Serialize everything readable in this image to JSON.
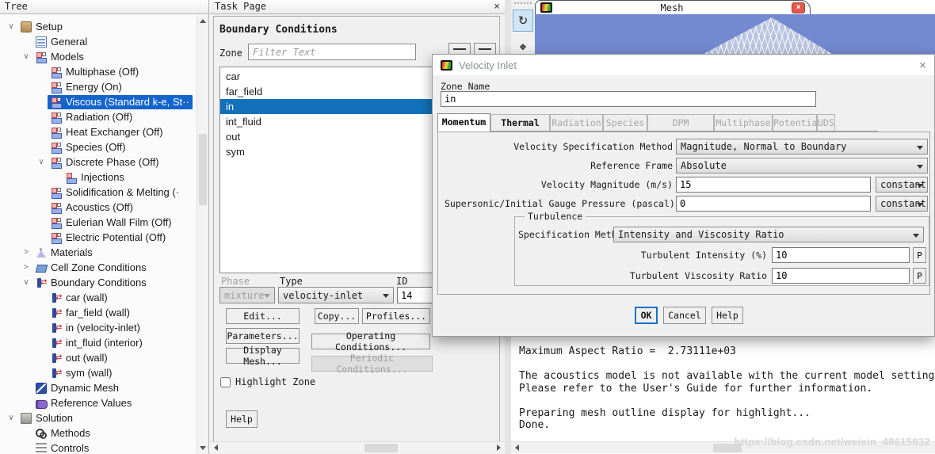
{
  "icons": {
    "close": "×",
    "expand_open": "∨",
    "expand_closed": ">"
  },
  "colors": {
    "selection_blue": "#1271b8",
    "tree_selection_blue": "#1464cc",
    "viewport_blue": "#7389cf",
    "tab_close_red": "#e2574c",
    "ok_border_blue": "#1373c6",
    "watermark_gray": "#d7d7d7"
  },
  "tree": {
    "header": "Tree",
    "items": [
      {
        "arrow": "v",
        "icon": "setup",
        "label": "Setup",
        "lvl": 0
      },
      {
        "icon": "general",
        "label": "General",
        "lvl": 1
      },
      {
        "arrow": "v",
        "icon": "model",
        "label": "Models",
        "lvl": 1
      },
      {
        "icon": "model",
        "label": "Multiphase (Off)",
        "lvl": 2
      },
      {
        "icon": "model",
        "label": "Energy (On)",
        "lvl": 2
      },
      {
        "icon": "model",
        "label": "Viscous (Standard k-e, St··",
        "lvl": 2,
        "selected": true
      },
      {
        "icon": "model",
        "label": "Radiation (Off)",
        "lvl": 2
      },
      {
        "icon": "model",
        "label": "Heat Exchanger (Off)",
        "lvl": 2
      },
      {
        "icon": "model",
        "label": "Species (Off)",
        "lvl": 2
      },
      {
        "arrow": "v",
        "icon": "model",
        "label": "Discrete Phase (Off)",
        "lvl": 2
      },
      {
        "icon": "injections",
        "label": "Injections",
        "lvl": 3
      },
      {
        "icon": "model",
        "label": "Solidification & Melting (·",
        "lvl": 2
      },
      {
        "icon": "model",
        "label": "Acoustics (Off)",
        "lvl": 2
      },
      {
        "icon": "model",
        "label": "Eulerian Wall Film (Off)",
        "lvl": 2
      },
      {
        "icon": "model",
        "label": "Electric Potential (Off)",
        "lvl": 2
      },
      {
        "arrow": ">",
        "icon": "materials",
        "label": "Materials",
        "lvl": 1
      },
      {
        "arrow": ">",
        "icon": "cellzone",
        "label": "Cell Zone Conditions",
        "lvl": 1
      },
      {
        "arrow": "v",
        "icon": "boundary",
        "label": "Boundary Conditions",
        "lvl": 1
      },
      {
        "icon": "boundary",
        "label": "car (wall)",
        "lvl": 2
      },
      {
        "icon": "boundary",
        "label": "far_field (wall)",
        "lvl": 2
      },
      {
        "icon": "boundary",
        "label": "in (velocity-inlet)",
        "lvl": 2
      },
      {
        "icon": "boundary",
        "label": "int_fluid (interior)",
        "lvl": 2
      },
      {
        "icon": "boundary",
        "label": "out (wall)",
        "lvl": 2
      },
      {
        "icon": "boundary",
        "label": "sym (wall)",
        "lvl": 2
      },
      {
        "icon": "dynmesh",
        "label": "Dynamic Mesh",
        "lvl": 1
      },
      {
        "icon": "refvals",
        "label": "Reference Values",
        "lvl": 1
      },
      {
        "arrow": "v",
        "icon": "solution",
        "label": "Solution",
        "lvl": 0
      },
      {
        "icon": "methods",
        "label": "Methods",
        "lvl": 1
      },
      {
        "icon": "controls",
        "label": "Controls",
        "lvl": 1
      }
    ]
  },
  "task_page": {
    "header": "Task Page",
    "title": "Boundary Conditions",
    "zone_label": "Zone",
    "filter_placeholder": "Filter Text",
    "zones": [
      {
        "name": "car"
      },
      {
        "name": "far_field"
      },
      {
        "name": "in",
        "selected": true
      },
      {
        "name": "int_fluid"
      },
      {
        "name": "out"
      },
      {
        "name": "sym"
      }
    ],
    "phase_label": "Phase",
    "phase_value": "mixture",
    "type_label": "Type",
    "type_value": "velocity-inlet",
    "id_label": "ID",
    "id_value": "14",
    "buttons": {
      "edit": "Edit...",
      "copy": "Copy...",
      "profiles": "Profiles...",
      "parameters": "Parameters...",
      "operating": "Operating Conditions...",
      "display_mesh": "Display Mesh...",
      "periodic": "Periodic Conditions...",
      "help": "Help"
    },
    "highlight_zone_label": "Highlight Zone"
  },
  "graphics": {
    "tab_title": "Mesh"
  },
  "dialog": {
    "title": "Velocity Inlet",
    "zone_name_label": "Zone Name",
    "zone_name_value": "in",
    "tabs": [
      {
        "label": "Momentum",
        "state": "active"
      },
      {
        "label": "Thermal",
        "state": "enabled"
      },
      {
        "label": "Radiation",
        "state": "disabled"
      },
      {
        "label": "Species",
        "state": "disabled"
      },
      {
        "label": "DPM",
        "state": "disabled"
      },
      {
        "label": "Multiphase",
        "state": "disabled"
      },
      {
        "label": "Potential",
        "state": "disabled"
      },
      {
        "label": "UDS",
        "state": "disabled"
      }
    ],
    "fields": {
      "vsm_label": "Velocity Specification Method",
      "vsm_value": "Magnitude, Normal to Boundary",
      "rf_label": "Reference Frame",
      "rf_value": "Absolute",
      "vm_label": "Velocity Magnitude (m/s)",
      "vm_value": "15",
      "vm_profile": "constant",
      "sp_label": "Supersonic/Initial Gauge Pressure (pascal)",
      "sp_value": "0",
      "sp_profile": "constant"
    },
    "turbulence": {
      "legend": "Turbulence",
      "sm_label": "Specification Method",
      "sm_value": "Intensity and Viscosity Ratio",
      "ti_label": "Turbulent Intensity (%)",
      "ti_value": "10",
      "tvr_label": "Turbulent Viscosity Ratio",
      "tvr_value": "10",
      "p_button": "P"
    },
    "buttons": {
      "ok": "OK",
      "cancel": "Cancel",
      "help": "Help"
    }
  },
  "console": {
    "lines": [
      {
        "t": "Maximum Aspect Ratio =  2.73111e+03"
      },
      {
        "t": ""
      },
      {
        "t": "The acoustics model is not available with the current model settings."
      },
      {
        "t": "Please refer to the User's Guide for further information."
      },
      {
        "t": ""
      },
      {
        "t": "Preparing mesh outline display for highlight..."
      },
      {
        "t": "Done."
      }
    ],
    "watermark": "https://blog.csdn.net/weixin_48615832"
  }
}
